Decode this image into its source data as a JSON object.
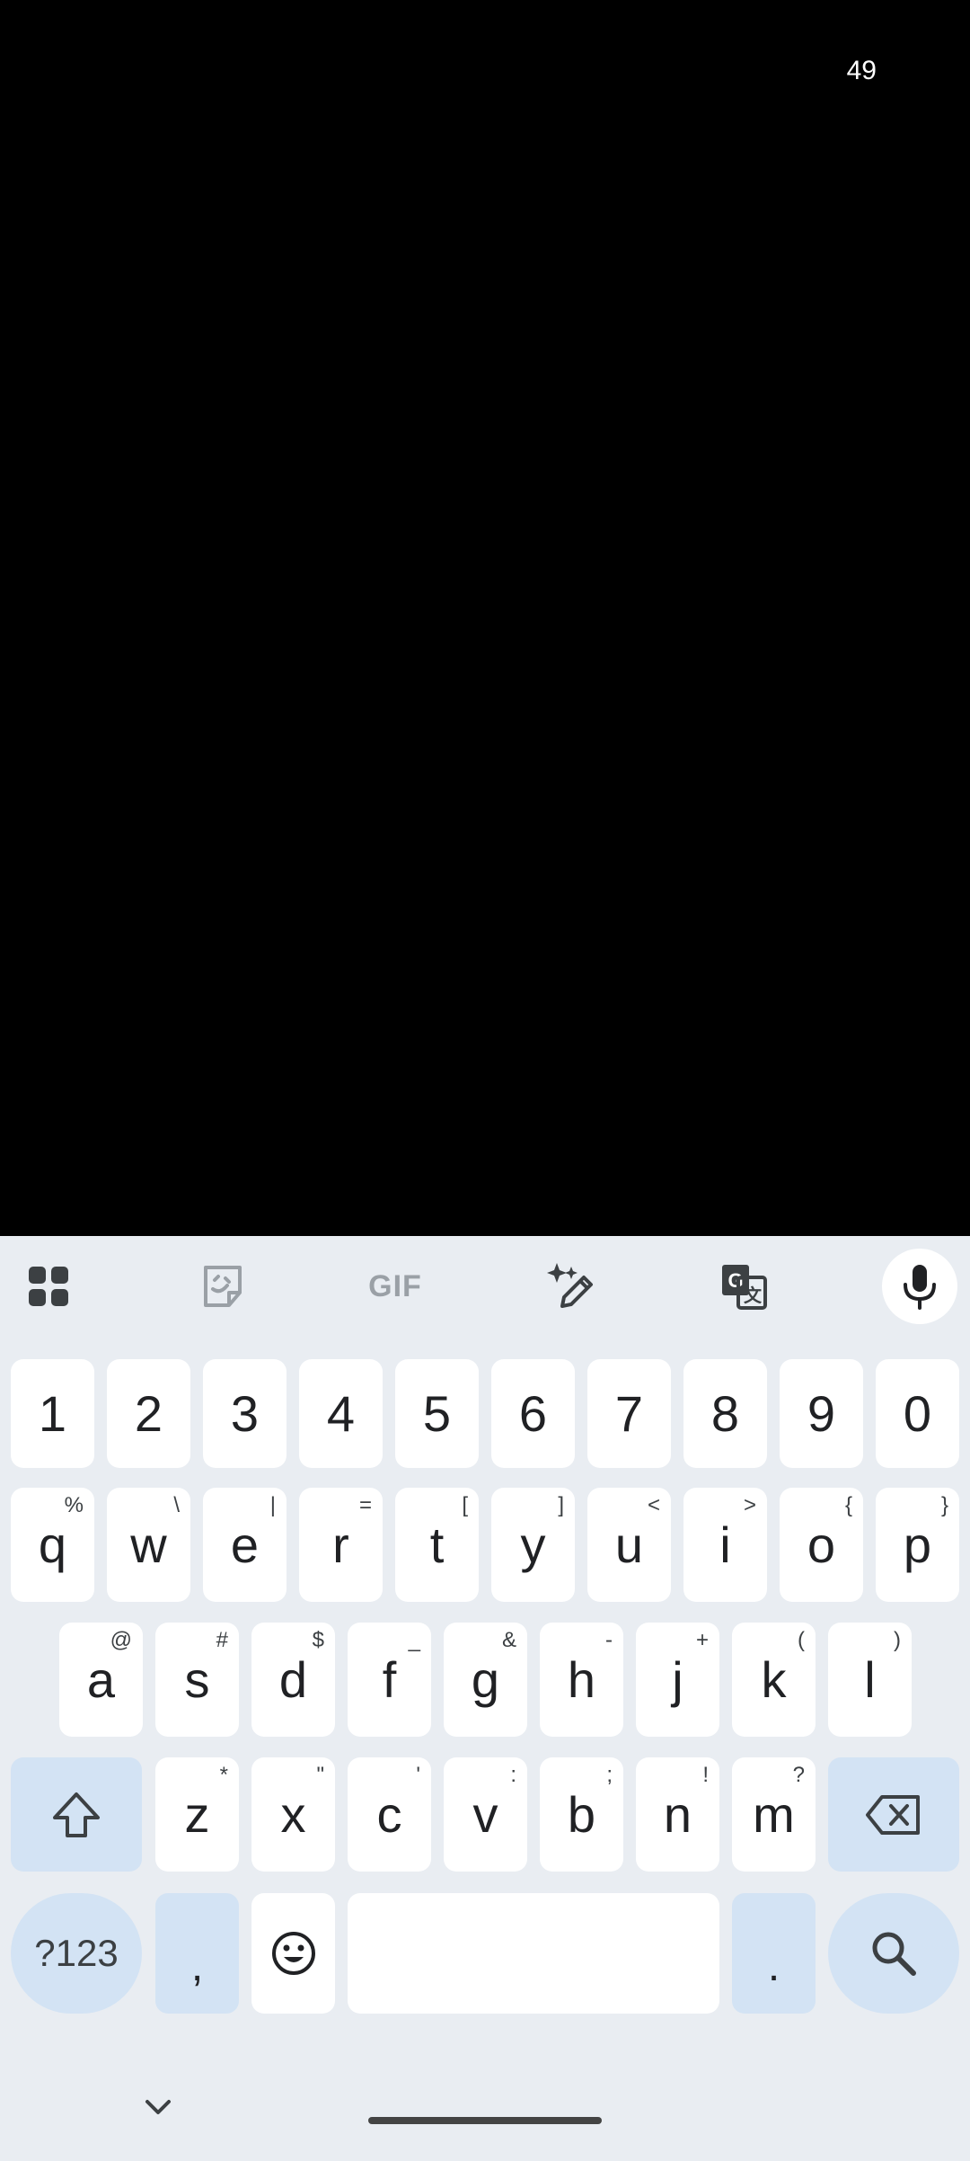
{
  "status": {
    "time": "49"
  },
  "toolbar": {
    "items": [
      "apps-grid-icon",
      "sticker-icon",
      "GIF",
      "magic-write-icon",
      "translate-icon",
      "mic-icon"
    ],
    "gif_label": "GIF"
  },
  "keyboard": {
    "number_row": [
      "1",
      "2",
      "3",
      "4",
      "5",
      "6",
      "7",
      "8",
      "9",
      "0"
    ],
    "row1": [
      {
        "key": "q",
        "hint": "%"
      },
      {
        "key": "w",
        "hint": "\\"
      },
      {
        "key": "e",
        "hint": "|"
      },
      {
        "key": "r",
        "hint": "="
      },
      {
        "key": "t",
        "hint": "["
      },
      {
        "key": "y",
        "hint": "]"
      },
      {
        "key": "u",
        "hint": "<"
      },
      {
        "key": "i",
        "hint": ">"
      },
      {
        "key": "o",
        "hint": "{"
      },
      {
        "key": "p",
        "hint": "}"
      }
    ],
    "row2": [
      {
        "key": "a",
        "hint": "@"
      },
      {
        "key": "s",
        "hint": "#"
      },
      {
        "key": "d",
        "hint": "$"
      },
      {
        "key": "f",
        "hint": "_"
      },
      {
        "key": "g",
        "hint": "&"
      },
      {
        "key": "h",
        "hint": "-"
      },
      {
        "key": "j",
        "hint": "+"
      },
      {
        "key": "k",
        "hint": "("
      },
      {
        "key": "l",
        "hint": ")"
      }
    ],
    "row3": [
      {
        "key": "z",
        "hint": "*"
      },
      {
        "key": "x",
        "hint": "\""
      },
      {
        "key": "c",
        "hint": "'"
      },
      {
        "key": "v",
        "hint": ":"
      },
      {
        "key": "b",
        "hint": ";"
      },
      {
        "key": "n",
        "hint": "!"
      },
      {
        "key": "m",
        "hint": "?"
      }
    ],
    "symbols_label": "?123",
    "comma": ",",
    "period": "."
  }
}
